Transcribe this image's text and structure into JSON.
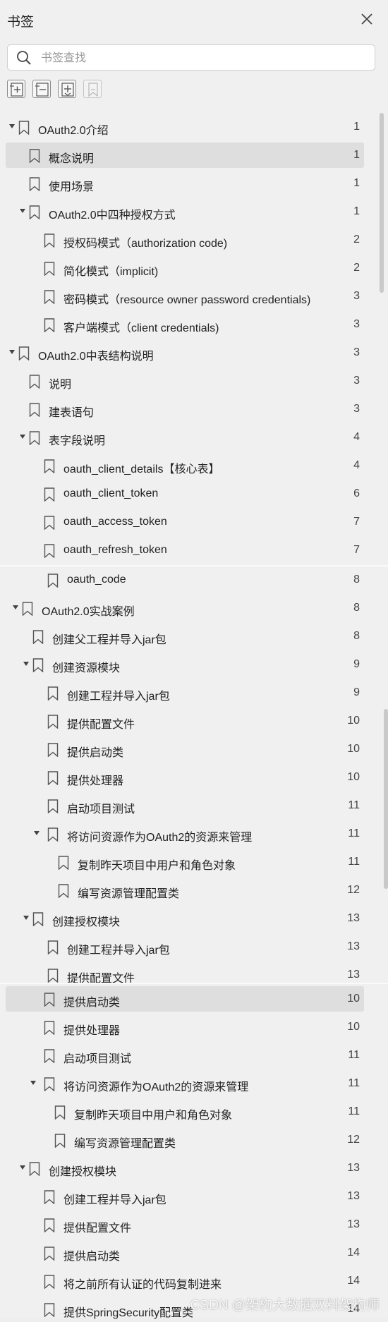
{
  "header": {
    "title": "书签"
  },
  "search": {
    "placeholder": "书签查找"
  },
  "toolbar": {
    "buttons": [
      {
        "name": "expand-all-button",
        "icon": "expand-all-icon",
        "enabled": true
      },
      {
        "name": "collapse-all-button",
        "icon": "collapse-all-icon",
        "enabled": true
      },
      {
        "name": "add-bookmark-button",
        "icon": "add-bookmark-icon",
        "enabled": true
      },
      {
        "name": "bookmark-button",
        "icon": "bookmark-icon",
        "enabled": false
      }
    ]
  },
  "bookmarks": [
    {
      "label": "OAuth2.0介绍",
      "page": "1",
      "level": 0,
      "expanded": true
    },
    {
      "label": "概念说明",
      "page": "1",
      "level": 1,
      "selected": true
    },
    {
      "label": "使用场景",
      "page": "1",
      "level": 1
    },
    {
      "label": "OAuth2.0中四种授权方式",
      "page": "1",
      "level": 1,
      "expanded": true
    },
    {
      "label": "授权码模式（authorization code)",
      "page": "2",
      "level": 2
    },
    {
      "label": "简化模式（implicit)",
      "page": "2",
      "level": 2
    },
    {
      "label": "密码模式（resource owner password credentials)",
      "page": "3",
      "level": 2
    },
    {
      "label": "客户端模式（client credentials)",
      "page": "3",
      "level": 2
    },
    {
      "label": "OAuth2.0中表结构说明",
      "page": "3",
      "level": 0,
      "expanded": true
    },
    {
      "label": "说明",
      "page": "3",
      "level": 1
    },
    {
      "label": "建表语句",
      "page": "3",
      "level": 1
    },
    {
      "label": "表字段说明",
      "page": "4",
      "level": 1,
      "expanded": true
    },
    {
      "label": "oauth_client_details【核心表】",
      "page": "4",
      "level": 2
    },
    {
      "label": "oauth_client_token",
      "page": "6",
      "level": 2
    },
    {
      "label": "oauth_access_token",
      "page": "7",
      "level": 2
    },
    {
      "label": "oauth_refresh_token",
      "page": "7",
      "level": 2
    },
    {
      "label": "oauth_code",
      "page": "8",
      "level": 2
    },
    {
      "label": "OAuth2.0实战案例",
      "page": "8",
      "level": 0,
      "expanded": true
    },
    {
      "label": "创建父工程并导入jar包",
      "page": "8",
      "level": 1
    },
    {
      "label": "创建资源模块",
      "page": "9",
      "level": 1,
      "expanded": true
    },
    {
      "label": "创建工程并导入jar包",
      "page": "9",
      "level": 2
    },
    {
      "label": "提供配置文件",
      "page": "10",
      "level": 2
    },
    {
      "label": "提供启动类",
      "page": "10",
      "level": 2
    },
    {
      "label": "提供处理器",
      "page": "10",
      "level": 2
    },
    {
      "label": "启动项目测试",
      "page": "11",
      "level": 2
    },
    {
      "label": "将访问资源作为OAuth2的资源来管理",
      "page": "11",
      "level": 2,
      "expanded": true
    },
    {
      "label": "复制昨天项目中用户和角色对象",
      "page": "11",
      "level": 3
    },
    {
      "label": "编写资源管理配置类",
      "page": "12",
      "level": 3
    },
    {
      "label": "创建授权模块",
      "page": "13",
      "level": 1,
      "expanded": true
    },
    {
      "label": "创建工程并导入jar包",
      "page": "13",
      "level": 2
    },
    {
      "label": "提供配置文件",
      "page": "13",
      "level": 2
    },
    {
      "label": "提供启动类",
      "page": "10",
      "level": 2,
      "selected": true
    },
    {
      "label": "提供处理器",
      "page": "10",
      "level": 2
    },
    {
      "label": "启动项目测试",
      "page": "11",
      "level": 2
    },
    {
      "label": "将访问资源作为OAuth2的资源来管理",
      "page": "11",
      "level": 2,
      "expanded": true
    },
    {
      "label": "复制昨天项目中用户和角色对象",
      "page": "11",
      "level": 3
    },
    {
      "label": "编写资源管理配置类",
      "page": "12",
      "level": 3
    },
    {
      "label": "创建授权模块",
      "page": "13",
      "level": 1,
      "expanded": true
    },
    {
      "label": "创建工程并导入jar包",
      "page": "13",
      "level": 2
    },
    {
      "label": "提供配置文件",
      "page": "13",
      "level": 2
    },
    {
      "label": "提供启动类",
      "page": "14",
      "level": 2
    },
    {
      "label": "将之前所有认证的代码复制进来",
      "page": "14",
      "level": 2
    },
    {
      "label": "提供SpringSecurity配置类",
      "page": "14",
      "level": 2
    }
  ],
  "watermark": "CSDN @架构大数据双料架构师",
  "colors": {
    "background": "#f0f0f0",
    "selected_row": "#dedede",
    "icon": "#555555"
  }
}
